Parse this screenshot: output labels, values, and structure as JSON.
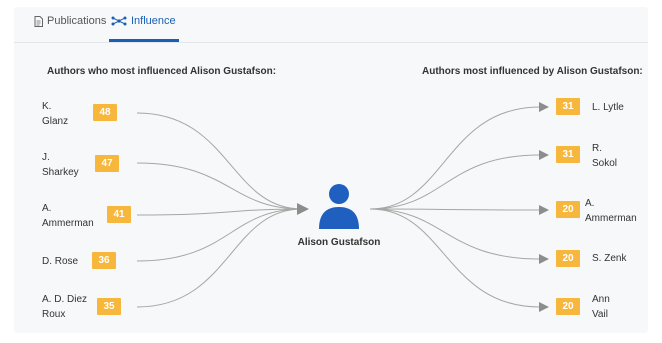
{
  "tabs": {
    "publications": "Publications",
    "influence": "Influence"
  },
  "left": {
    "header": "Authors who most influenced Alison Gustafson:",
    "authors": [
      {
        "line1": "K.",
        "line2": "Glanz",
        "count": "48"
      },
      {
        "line1": "J.",
        "line2": "Sharkey",
        "count": "47"
      },
      {
        "line1": "A.",
        "line2": "Ammerman",
        "count": "41"
      },
      {
        "line1": "D. Rose",
        "line2": "",
        "count": "36"
      },
      {
        "line1": "A. D. Diez",
        "line2": "Roux",
        "count": "35"
      }
    ]
  },
  "right": {
    "header": "Authors most influenced by Alison Gustafson:",
    "authors": [
      {
        "line1": "L. Lytle",
        "line2": "",
        "count": "31"
      },
      {
        "line1": "R.",
        "line2": "Sokol",
        "count": "31"
      },
      {
        "line1": "A.",
        "line2": "Ammerman",
        "count": "20"
      },
      {
        "line1": "S. Zenk",
        "line2": "",
        "count": "20"
      },
      {
        "line1": "Ann",
        "line2": "Vail",
        "count": "20"
      }
    ]
  },
  "center": {
    "name": "Alison Gustafson",
    "icon": "person-icon"
  },
  "colors": {
    "accent": "#1a5fb4",
    "badge": "#f6b73c",
    "avatar": "#1f5fbf",
    "curve": "#9a9a9a"
  }
}
